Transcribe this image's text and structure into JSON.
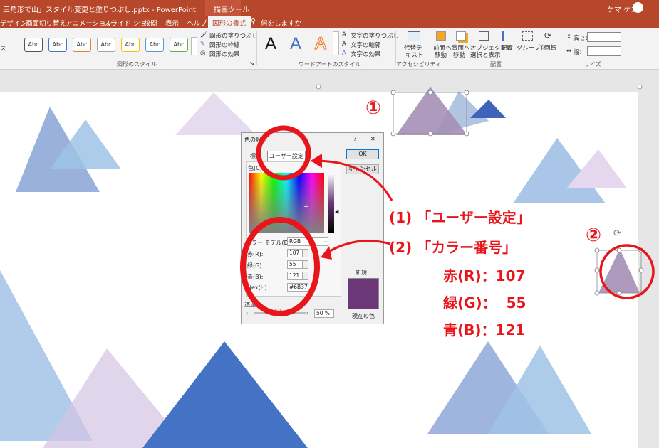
{
  "titlebar": {
    "title": "三角形で山」スタイル変更と塗りつぶし.pptx  -  PowerPoint",
    "context_tool": "描画ツール",
    "user": "ケマ ケコ"
  },
  "tabs": [
    "デザイン",
    "画面切り替え",
    "アニメーション",
    "スライド ショー",
    "校閲",
    "表示",
    "ヘルプ",
    "図形の書式",
    "何をしますか"
  ],
  "ribbon": {
    "style_label": "Abc",
    "fill": "図形の塗りつぶし",
    "outline": "図形の枠線",
    "effects": "図形の効果",
    "group_shape_styles": "図形のスタイル",
    "wordart_letter": "A",
    "text_fill": "文字の塗りつぶし",
    "text_outline": "文字の輪郭",
    "text_effects": "文字の効果",
    "group_wordart": "ワードアートのスタイル",
    "alt_text_1": "代替テ",
    "alt_text_2": "キスト",
    "group_accessibility": "アクセシビリティ",
    "bring_forward_1": "前面へ",
    "bring_forward_2": "移動",
    "send_backward_1": "背面へ",
    "send_backward_2": "移動",
    "selection_1": "オブジェクトの",
    "selection_2": "選択と表示",
    "align": "配置",
    "group": "グループ化",
    "rotate": "回転",
    "group_arrange": "配置",
    "height": "高さ:",
    "width": "幅:",
    "group_size": "サイズ",
    "left_cut": "ス"
  },
  "dialog": {
    "title": "色の設定",
    "help": "?",
    "close": "✕",
    "tab_standard": "標準",
    "tab_custom": "ユーザー設定",
    "ok": "OK",
    "cancel": "キャンセル",
    "colors_label": "色(C):",
    "color_model_label": "カラー モデル(D):",
    "color_model_value": "RGB",
    "red_label": "赤(R):",
    "red_value": "107",
    "green_label": "緑(G):",
    "green_value": "55",
    "blue_label": "青(B):",
    "blue_value": "121",
    "hex_label": "Hex(H):",
    "hex_value": "#6B37",
    "transparency_label": "透過",
    "transparency_value": "50 %",
    "new_label": "新規",
    "current_label": "現在の色",
    "new_color": "#6b3779"
  },
  "annotations": {
    "marker1": "①",
    "marker2": "②",
    "step1": "(1) 「ユーザー設定」",
    "step2": "(2) 「カラー番号」",
    "red": "赤(R)：107",
    "green": "緑(G)：  55",
    "blue": "青(B)：121"
  },
  "colors": {
    "accent": "#b7472a",
    "annotation": "#e8151b",
    "triangle_purple": "#a48fb5",
    "triangle_blue": "#4472c4",
    "triangle_lightblue": "#9dc3e6",
    "triangle_lavender": "#e0d3ea"
  }
}
